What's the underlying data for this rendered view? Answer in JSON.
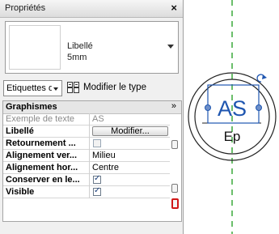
{
  "panel": {
    "title": "Propriétés",
    "close": "×"
  },
  "type_selector": {
    "name": "Libellé",
    "size": "5mm"
  },
  "selector": {
    "filter": "Etiquettes de s",
    "edit_type": "Modifier le type"
  },
  "grid": {
    "group": "Graphismes",
    "rows": [
      {
        "name": "Exemple de texte",
        "value": "AS"
      },
      {
        "name": "Libellé",
        "value": "Modifier..."
      },
      {
        "name": "Retournement ...",
        "value": ""
      },
      {
        "name": "Alignement ver...",
        "value": "Milieu"
      },
      {
        "name": "Alignement hor...",
        "value": "Centre"
      },
      {
        "name": "Conserver en le...",
        "value": ""
      },
      {
        "name": "Visible",
        "value": ""
      }
    ],
    "checkboxes": {
      "retournement": false,
      "conserver": true,
      "visible": true
    }
  },
  "symbol": {
    "top_text": "AS",
    "bottom_text": "Ep"
  },
  "colors": {
    "accent": "#1f56b0",
    "axis": "#3aa83a",
    "highlight": "#d01818"
  }
}
